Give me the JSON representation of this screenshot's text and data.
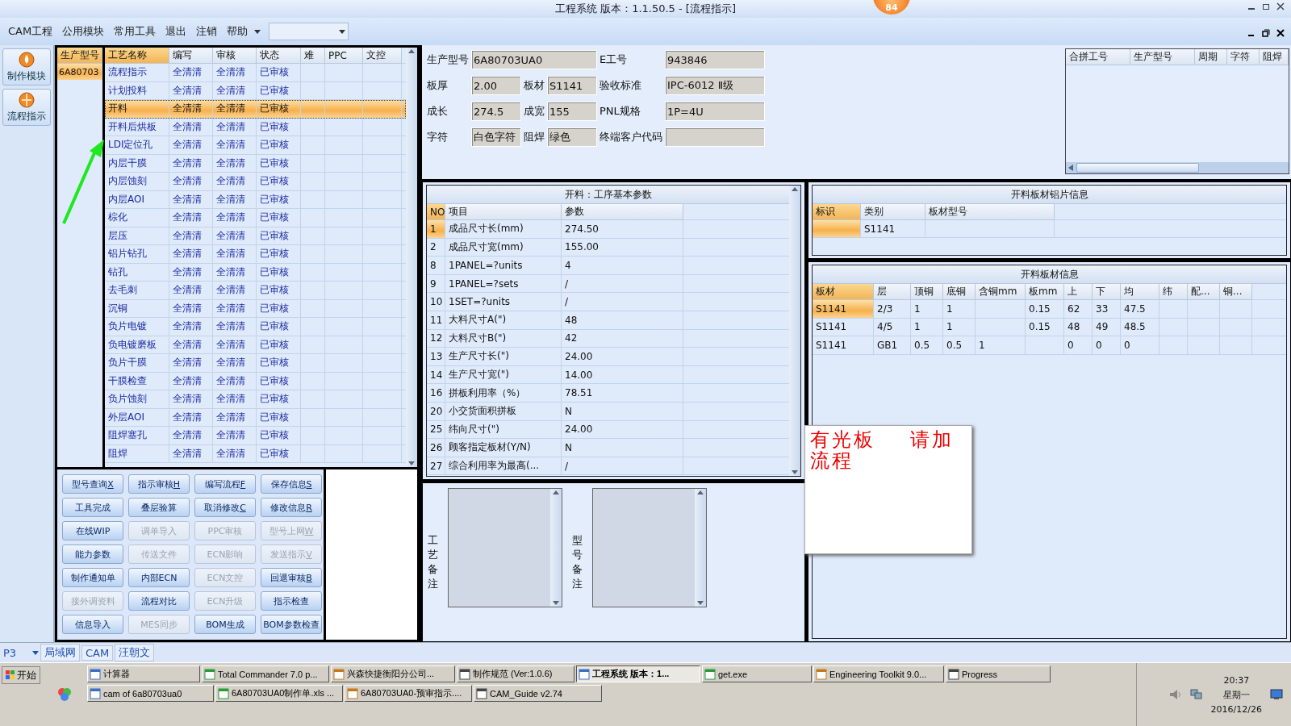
{
  "window": {
    "title": "工程系统  版本：1.1.50.5 - [流程指示]",
    "badge": "84"
  },
  "menu": {
    "items": [
      "CAM工程",
      "公用模块",
      "常用工具",
      "退出",
      "注销",
      "帮助"
    ]
  },
  "nav": [
    {
      "label": "制作模块"
    },
    {
      "label": "流程指示"
    }
  ],
  "model_list": {
    "header": "生产型号",
    "rows": [
      {
        "value": "6A80703",
        "selected": true
      }
    ]
  },
  "process_table": {
    "columns": [
      "工艺名称",
      "编写",
      "审核",
      "状态",
      "难",
      "PPC",
      "文控"
    ],
    "rows": [
      {
        "name": "流程指示",
        "writer": "全清清",
        "reviewer": "全清清",
        "status": "已审核",
        "selected": false
      },
      {
        "name": "计划投料",
        "writer": "全清清",
        "reviewer": "全清清",
        "status": "已审核",
        "selected": false
      },
      {
        "name": "开料",
        "writer": "全清清",
        "reviewer": "全清清",
        "status": "已审核",
        "selected": true
      },
      {
        "name": "开料后烘板",
        "writer": "全清清",
        "reviewer": "全清清",
        "status": "已审核",
        "selected": false
      },
      {
        "name": "LDI定位孔",
        "writer": "全清清",
        "reviewer": "全清清",
        "status": "已审核",
        "selected": false
      },
      {
        "name": "内层干膜",
        "writer": "全清清",
        "reviewer": "全清清",
        "status": "已审核",
        "selected": false
      },
      {
        "name": "内层蚀刻",
        "writer": "全清清",
        "reviewer": "全清清",
        "status": "已审核",
        "selected": false
      },
      {
        "name": "内层AOI",
        "writer": "全清清",
        "reviewer": "全清清",
        "status": "已审核",
        "selected": false
      },
      {
        "name": "棕化",
        "writer": "全清清",
        "reviewer": "全清清",
        "status": "已审核",
        "selected": false
      },
      {
        "name": "层压",
        "writer": "全清清",
        "reviewer": "全清清",
        "status": "已审核",
        "selected": false
      },
      {
        "name": "铝片钻孔",
        "writer": "全清清",
        "reviewer": "全清清",
        "status": "已审核",
        "selected": false
      },
      {
        "name": "钻孔",
        "writer": "全清清",
        "reviewer": "全清清",
        "status": "已审核",
        "selected": false
      },
      {
        "name": "去毛刺",
        "writer": "全清清",
        "reviewer": "全清清",
        "status": "已审核",
        "selected": false
      },
      {
        "name": "沉铜",
        "writer": "全清清",
        "reviewer": "全清清",
        "status": "已审核",
        "selected": false
      },
      {
        "name": "负片电镀",
        "writer": "全清清",
        "reviewer": "全清清",
        "status": "已审核",
        "selected": false
      },
      {
        "name": "负电镀磨板",
        "writer": "全清清",
        "reviewer": "全清清",
        "status": "已审核",
        "selected": false
      },
      {
        "name": "负片干膜",
        "writer": "全清清",
        "reviewer": "全清清",
        "status": "已审核",
        "selected": false
      },
      {
        "name": "干膜检查",
        "writer": "全清清",
        "reviewer": "全清清",
        "status": "已审核",
        "selected": false
      },
      {
        "name": "负片蚀刻",
        "writer": "全清清",
        "reviewer": "全清清",
        "status": "已审核",
        "selected": false
      },
      {
        "name": "外层AOI",
        "writer": "全清清",
        "reviewer": "全清清",
        "status": "已审核",
        "selected": false
      },
      {
        "name": "阻焊塞孔",
        "writer": "全清清",
        "reviewer": "全清清",
        "status": "已审核",
        "selected": false
      },
      {
        "name": "阻焊",
        "writer": "全清清",
        "reviewer": "全清清",
        "status": "已审核",
        "selected": false
      }
    ]
  },
  "buttons": [
    {
      "label": "型号查询",
      "hotkey": "X",
      "disabled": false
    },
    {
      "label": "指示审核",
      "hotkey": "H",
      "disabled": false
    },
    {
      "label": "编写流程",
      "hotkey": "F",
      "disabled": false
    },
    {
      "label": "保存信息",
      "hotkey": "S",
      "disabled": false
    },
    {
      "label": "工具完成",
      "disabled": false
    },
    {
      "label": "叠层验算",
      "disabled": false
    },
    {
      "label": "取消修改",
      "hotkey": "C",
      "disabled": false
    },
    {
      "label": "修改信息",
      "hotkey": "R",
      "disabled": false
    },
    {
      "label": "在线WIP",
      "disabled": false
    },
    {
      "label": "调单导入",
      "disabled": true
    },
    {
      "label": "PPC审核",
      "disabled": true
    },
    {
      "label": "型号上网",
      "hotkey": "W",
      "disabled": true
    },
    {
      "label": "能力参数",
      "disabled": false
    },
    {
      "label": "传送文件",
      "disabled": true
    },
    {
      "label": "ECN影响",
      "disabled": true
    },
    {
      "label": "发送指示",
      "hotkey": "V",
      "disabled": true
    },
    {
      "label": "制作通知单",
      "disabled": false
    },
    {
      "label": "内部ECN",
      "disabled": false
    },
    {
      "label": "ECN文控",
      "disabled": true
    },
    {
      "label": "回退审核",
      "hotkey": "B",
      "disabled": false
    },
    {
      "label": "接外调资料",
      "disabled": true
    },
    {
      "label": "流程对比",
      "disabled": false
    },
    {
      "label": "ECN升级",
      "disabled": true
    },
    {
      "label": "指示检查",
      "disabled": false
    },
    {
      "label": "信息导入",
      "disabled": false
    },
    {
      "label": "MES同步",
      "disabled": true
    },
    {
      "label": "BOM生成",
      "disabled": false
    },
    {
      "label": "BOM参数检查",
      "disabled": false
    }
  ],
  "info": [
    [
      {
        "label": "生产型号",
        "value": "6A80703UA0"
      },
      {
        "label": "E工号",
        "value": "943846"
      }
    ],
    [
      {
        "label": "板厚",
        "value": "2.00"
      },
      {
        "label": "板材",
        "value": "S1141"
      },
      {
        "label": "验收标准",
        "value": "IPC-6012 Ⅱ级"
      }
    ],
    [
      {
        "label": "成长",
        "value": "274.5"
      },
      {
        "label": "成宽",
        "value": "155"
      },
      {
        "label": "PNL规格",
        "value": "1P=4U"
      }
    ],
    [
      {
        "label": "字符",
        "value": "白色字符"
      },
      {
        "label": "阻焊",
        "value": "绿色"
      },
      {
        "label": "终端客户代码"
      }
    ]
  ],
  "merge_table": {
    "columns": [
      "合拼工号",
      "生产型号",
      "周期",
      "字符",
      "阻焊"
    ]
  },
  "params": {
    "title": "开料：工序基本参数",
    "columns": [
      "NO",
      "项目",
      "参数"
    ],
    "rows": [
      {
        "no": "1",
        "item": "成品尺寸长(mm)",
        "value": "274.50",
        "selected": true
      },
      {
        "no": "2",
        "item": "成品尺寸宽(mm)",
        "value": "155.00",
        "selected": false
      },
      {
        "no": "8",
        "item": "1PANEL=?units",
        "value": "4",
        "selected": false
      },
      {
        "no": "9",
        "item": "1PANEL=?sets",
        "value": "/",
        "selected": false
      },
      {
        "no": "10",
        "item": "1SET=?units",
        "value": "/",
        "selected": false
      },
      {
        "no": "11",
        "item": "大料尺寸A(\")",
        "value": "48",
        "selected": false
      },
      {
        "no": "12",
        "item": "大料尺寸B(\")",
        "value": "42",
        "selected": false
      },
      {
        "no": "13",
        "item": "生产尺寸长(\")",
        "value": "24.00",
        "selected": false
      },
      {
        "no": "14",
        "item": "生产尺寸宽(\")",
        "value": "14.00",
        "selected": false
      },
      {
        "no": "16",
        "item": "拼板利用率（%）",
        "value": "78.51",
        "selected": false
      },
      {
        "no": "20",
        "item": "小交货面积拼板",
        "value": "N",
        "selected": false
      },
      {
        "no": "25",
        "item": "纬向尺寸(\")",
        "value": "24.00",
        "selected": false
      },
      {
        "no": "26",
        "item": "顾客指定板材(Y/N)",
        "value": "N",
        "selected": false
      },
      {
        "no": "27",
        "item": "综合利用率为最高(...",
        "value": "/",
        "selected": false
      }
    ]
  },
  "notes": [
    {
      "label": "工艺备注"
    },
    {
      "label": "型号备注"
    }
  ],
  "popup_note": {
    "text": "有光板    请加流程"
  },
  "aluminum": {
    "title": "开料板材铝片信息",
    "columns": [
      "标识",
      "类别",
      "板材型号"
    ],
    "rows": [
      {
        "cells": [
          null,
          "S1141",
          null
        ],
        "selected": true
      }
    ]
  },
  "board": {
    "title": "开料板材信息",
    "columns": [
      "板材",
      "层",
      "顶铜",
      "底铜",
      "含铜mm",
      "板mm",
      "上",
      "下",
      "均",
      "纬",
      "配...",
      "铜..."
    ],
    "rows": [
      {
        "cells": [
          "S1141",
          "2/3",
          "1",
          "1",
          null,
          "0.15",
          "62",
          "33",
          "47.5",
          null,
          null,
          null
        ],
        "selected": true
      },
      {
        "cells": [
          "S1141",
          "4/5",
          "1",
          "1",
          null,
          "0.15",
          "48",
          "49",
          "48.5",
          null,
          null,
          null
        ],
        "selected": false
      },
      {
        "cells": [
          "S1141",
          "GB1",
          "0.5",
          "0.5",
          "1",
          null,
          "0",
          "0",
          "0",
          null,
          null,
          null
        ],
        "selected": false
      }
    ]
  },
  "status_bar": {
    "dropdown": "P3",
    "tabs": [
      "局域网",
      "CAM",
      "汪朝文"
    ]
  },
  "taskbar": {
    "start": "开始",
    "rows": [
      [
        {
          "label": "计算器",
          "selected": false
        },
        {
          "label": "Total Commander 7.0 p...",
          "selected": false
        },
        {
          "label": "兴森快捷衡阳分公司...",
          "selected": false
        },
        {
          "label": "制作规范 (Ver:1.0.6)",
          "selected": false
        },
        {
          "label": "工程系统  版本：1...",
          "selected": true
        },
        {
          "label": "get.exe",
          "selected": false
        },
        {
          "label": "Engineering Toolkit 9.0...",
          "selected": false
        },
        {
          "label": "Progress",
          "selected": false
        }
      ],
      [
        {
          "label": "cam of 6a80703ua0",
          "selected": false
        },
        {
          "label": "6A80703UA0制作单.xls ...",
          "selected": false
        },
        {
          "label": "6A80703UA0-预审指示....",
          "selected": false
        },
        {
          "label": "CAM_Guide v2.74",
          "selected": false
        }
      ]
    ],
    "clock": {
      "time": "20:37",
      "day": "星期一",
      "date": "2016/12/26"
    }
  }
}
